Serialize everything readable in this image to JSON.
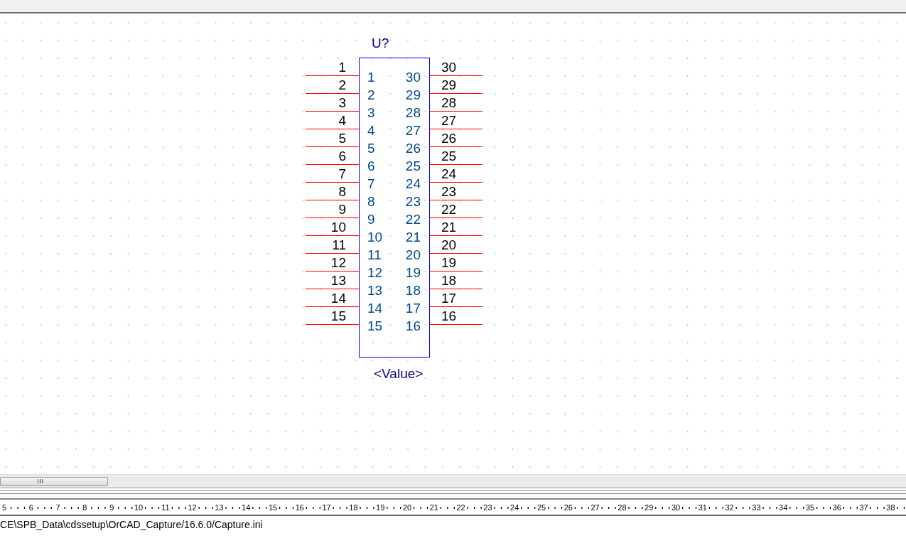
{
  "part": {
    "reference": "U?",
    "value": "<Value>",
    "left_pins": [
      {
        "number": "1",
        "name": "1"
      },
      {
        "number": "2",
        "name": "2"
      },
      {
        "number": "3",
        "name": "3"
      },
      {
        "number": "4",
        "name": "4"
      },
      {
        "number": "5",
        "name": "5"
      },
      {
        "number": "6",
        "name": "6"
      },
      {
        "number": "7",
        "name": "7"
      },
      {
        "number": "8",
        "name": "8"
      },
      {
        "number": "9",
        "name": "9"
      },
      {
        "number": "10",
        "name": "10"
      },
      {
        "number": "11",
        "name": "11"
      },
      {
        "number": "12",
        "name": "12"
      },
      {
        "number": "13",
        "name": "13"
      },
      {
        "number": "14",
        "name": "14"
      },
      {
        "number": "15",
        "name": "15"
      }
    ],
    "right_pins": [
      {
        "number": "30",
        "name": "30"
      },
      {
        "number": "29",
        "name": "29"
      },
      {
        "number": "28",
        "name": "28"
      },
      {
        "number": "27",
        "name": "27"
      },
      {
        "number": "26",
        "name": "26"
      },
      {
        "number": "25",
        "name": "25"
      },
      {
        "number": "24",
        "name": "24"
      },
      {
        "number": "23",
        "name": "23"
      },
      {
        "number": "22",
        "name": "22"
      },
      {
        "number": "21",
        "name": "21"
      },
      {
        "number": "20",
        "name": "20"
      },
      {
        "number": "19",
        "name": "19"
      },
      {
        "number": "18",
        "name": "18"
      },
      {
        "number": "17",
        "name": "17"
      },
      {
        "number": "16",
        "name": "16"
      }
    ]
  },
  "ruler": {
    "labels": [
      "5",
      "6",
      "7",
      "8",
      "9",
      "10",
      "11",
      "12",
      "13",
      "14",
      "15",
      "16",
      "17",
      "18",
      "19",
      "20",
      "21",
      "22",
      "23",
      "24",
      "25",
      "26",
      "27",
      "28",
      "29",
      "30",
      "31",
      "32",
      "33",
      "34",
      "35",
      "36",
      "37",
      "38"
    ]
  },
  "status_bar": {
    "text": "CE\\SPB_Data\\cdssetup\\OrCAD_Capture/16.6.0/Capture.ini"
  }
}
